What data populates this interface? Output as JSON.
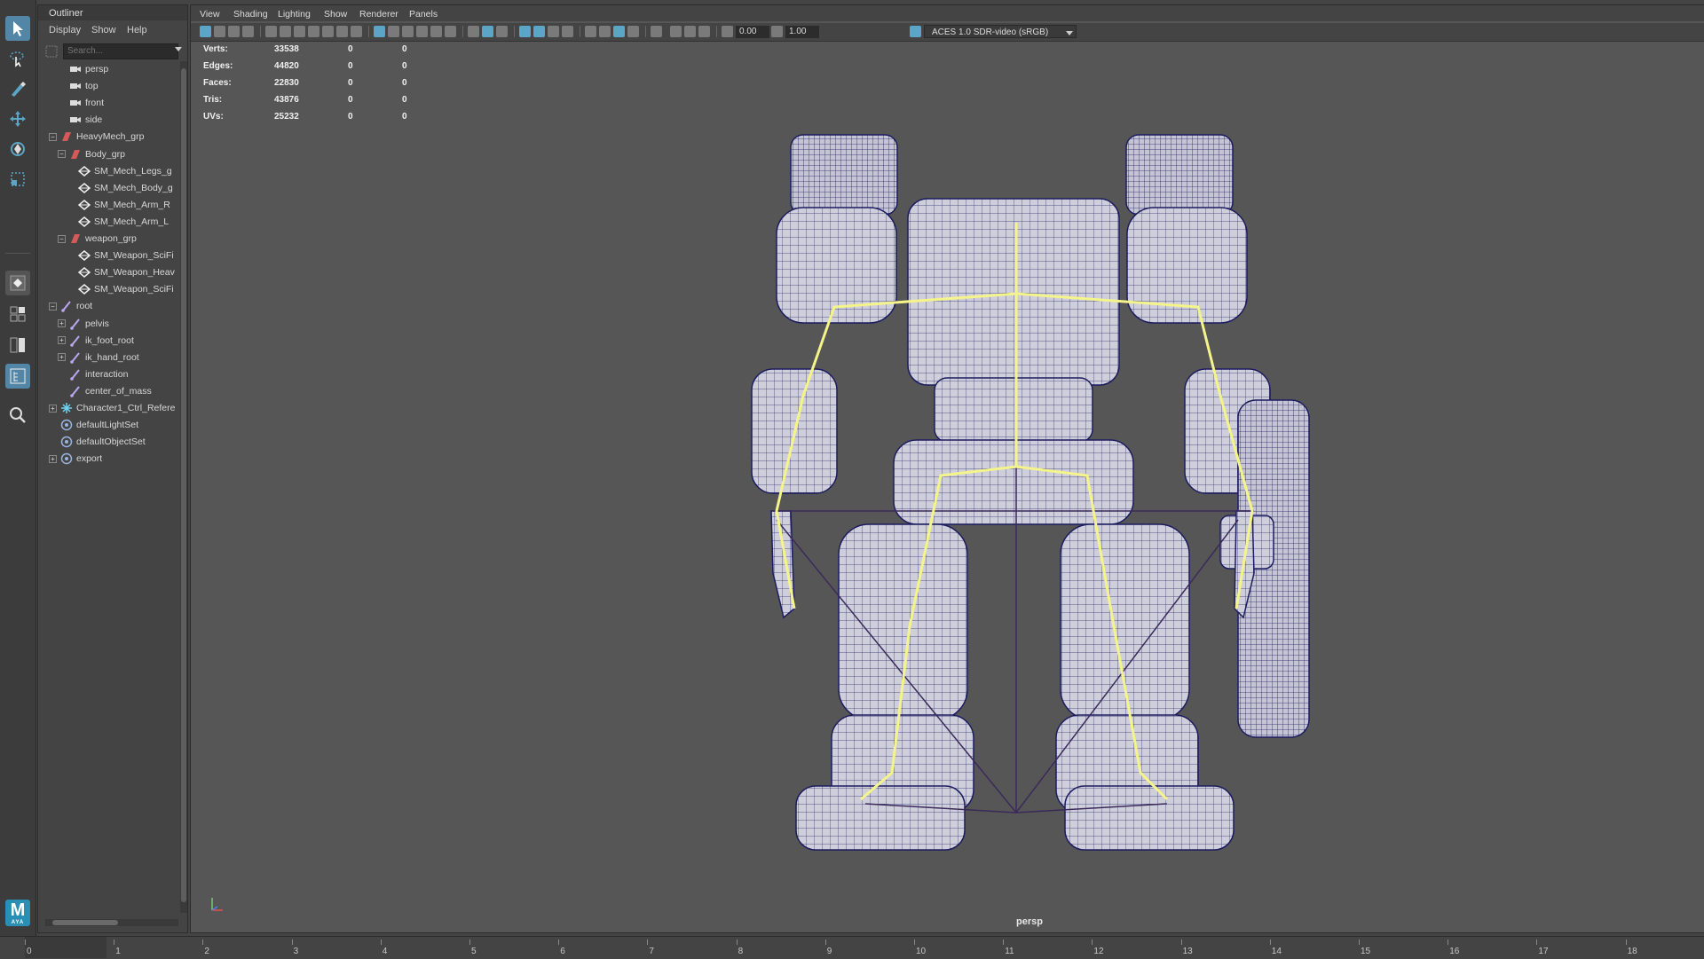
{
  "toolbox": {
    "tools": [
      {
        "name": "select-tool-icon"
      },
      {
        "name": "lasso-tool-icon"
      },
      {
        "name": "paint-select-tool-icon"
      },
      {
        "name": "move-tool-icon"
      },
      {
        "name": "rotate-tool-icon"
      },
      {
        "name": "scale-tool-icon"
      }
    ],
    "logo_text": "M",
    "logo_sub": "AYA"
  },
  "outliner": {
    "tab_title": "Outliner",
    "menu": [
      "Display",
      "Show",
      "Help"
    ],
    "search_placeholder": "Search...",
    "nodes": [
      {
        "label": "persp",
        "depth": 1,
        "icon": "camera-icon",
        "expand": ""
      },
      {
        "label": "top",
        "depth": 1,
        "icon": "camera-icon",
        "expand": ""
      },
      {
        "label": "front",
        "depth": 1,
        "icon": "camera-icon",
        "expand": ""
      },
      {
        "label": "side",
        "depth": 1,
        "icon": "camera-icon",
        "expand": ""
      },
      {
        "label": "HeavyMech_grp",
        "depth": 0,
        "icon": "group-icon",
        "expand": "−"
      },
      {
        "label": "Body_grp",
        "depth": 1,
        "icon": "group-icon",
        "expand": "−"
      },
      {
        "label": "SM_Mech_Legs_g",
        "depth": 2,
        "icon": "mesh-icon",
        "expand": ""
      },
      {
        "label": "SM_Mech_Body_g",
        "depth": 2,
        "icon": "mesh-icon",
        "expand": ""
      },
      {
        "label": "SM_Mech_Arm_R",
        "depth": 2,
        "icon": "mesh-icon",
        "expand": ""
      },
      {
        "label": "SM_Mech_Arm_L",
        "depth": 2,
        "icon": "mesh-icon",
        "expand": ""
      },
      {
        "label": "weapon_grp",
        "depth": 1,
        "icon": "group-icon",
        "expand": "−"
      },
      {
        "label": "SM_Weapon_SciFi",
        "depth": 2,
        "icon": "mesh-icon",
        "expand": ""
      },
      {
        "label": "SM_Weapon_Heav",
        "depth": 2,
        "icon": "mesh-icon",
        "expand": ""
      },
      {
        "label": "SM_Weapon_SciFi",
        "depth": 2,
        "icon": "mesh-icon",
        "expand": ""
      },
      {
        "label": "root",
        "depth": 0,
        "icon": "joint-icon",
        "expand": "−"
      },
      {
        "label": "pelvis",
        "depth": 1,
        "icon": "joint-icon",
        "expand": "+"
      },
      {
        "label": "ik_foot_root",
        "depth": 1,
        "icon": "joint-icon",
        "expand": "+"
      },
      {
        "label": "ik_hand_root",
        "depth": 1,
        "icon": "joint-icon",
        "expand": "+"
      },
      {
        "label": "interaction",
        "depth": 1,
        "icon": "joint-icon",
        "expand": ""
      },
      {
        "label": "center_of_mass",
        "depth": 1,
        "icon": "joint-icon",
        "expand": ""
      },
      {
        "label": "Character1_Ctrl_Refere",
        "depth": 0,
        "icon": "hik-icon",
        "expand": "+"
      },
      {
        "label": "defaultLightSet",
        "depth": 0,
        "icon": "set-icon",
        "expand": ""
      },
      {
        "label": "defaultObjectSet",
        "depth": 0,
        "icon": "set-icon",
        "expand": ""
      },
      {
        "label": "export",
        "depth": 0,
        "icon": "set-icon",
        "expand": "+"
      }
    ]
  },
  "viewport": {
    "menu": [
      "View",
      "Shading",
      "Lighting",
      "Show",
      "Renderer",
      "Panels"
    ],
    "exposure": "0.00",
    "gamma": "1.00",
    "color_space": "ACES 1.0 SDR-video (sRGB)",
    "camera_label": "persp",
    "hud": [
      {
        "label": "Verts:",
        "a": "33538",
        "b": "0",
        "c": "0"
      },
      {
        "label": "Edges:",
        "a": "44820",
        "b": "0",
        "c": "0"
      },
      {
        "label": "Faces:",
        "a": "22830",
        "b": "0",
        "c": "0"
      },
      {
        "label": "Tris:",
        "a": "43876",
        "b": "0",
        "c": "0"
      },
      {
        "label": "UVs:",
        "a": "25232",
        "b": "0",
        "c": "0"
      }
    ],
    "mesh_color": "#cfcfdc",
    "wire_color": "#1c1c5e",
    "skeleton_color": "#f4f48a"
  },
  "timeline": {
    "frames": [
      "0",
      "1",
      "2",
      "3",
      "4",
      "5",
      "6",
      "7",
      "8",
      "9",
      "10",
      "11",
      "12",
      "13",
      "14",
      "15",
      "16",
      "17",
      "18"
    ]
  }
}
